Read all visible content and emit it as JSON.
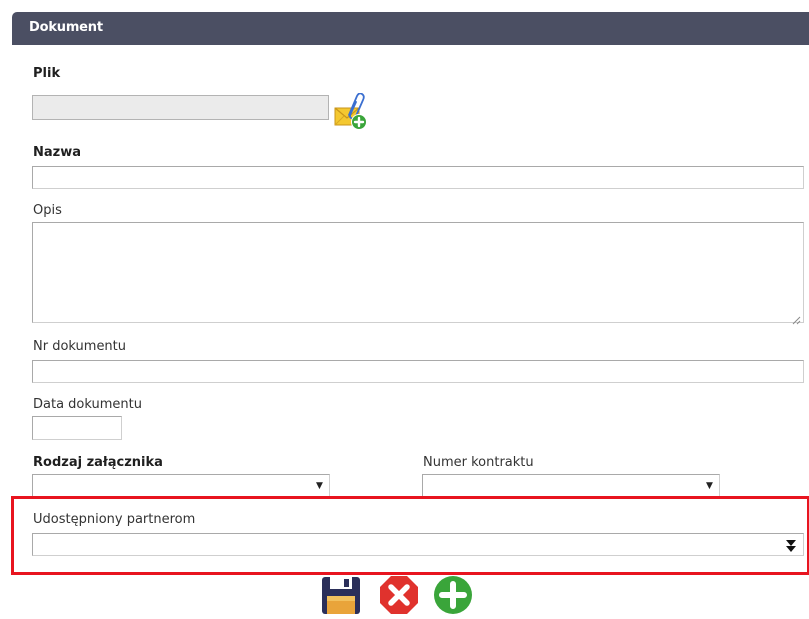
{
  "header": {
    "title": "Dokument"
  },
  "fields": {
    "plik": {
      "label": "Plik",
      "value": ""
    },
    "nazwa": {
      "label": "Nazwa",
      "value": ""
    },
    "opis": {
      "label": "Opis",
      "value": ""
    },
    "nr_dokumentu": {
      "label": "Nr dokumentu",
      "value": ""
    },
    "data_dokumentu": {
      "label": "Data dokumentu",
      "value": ""
    },
    "rodzaj_zalacznika": {
      "label": "Rodzaj załącznika",
      "selected": ""
    },
    "numer_kontraktu": {
      "label": "Numer kontraktu",
      "selected": ""
    },
    "udostepniony_partnerom": {
      "label": "Udostępniony partnerom",
      "selected": ""
    }
  },
  "icons": {
    "attach": "attach-envelope-icon",
    "save": "save-icon",
    "cancel": "cancel-icon",
    "add": "add-icon"
  },
  "colors": {
    "header_bg": "#4b4f63",
    "highlight": "#e8141f",
    "cancel_red": "#e0322d",
    "add_green": "#3aa53a",
    "save_navy": "#2b2f5a"
  }
}
